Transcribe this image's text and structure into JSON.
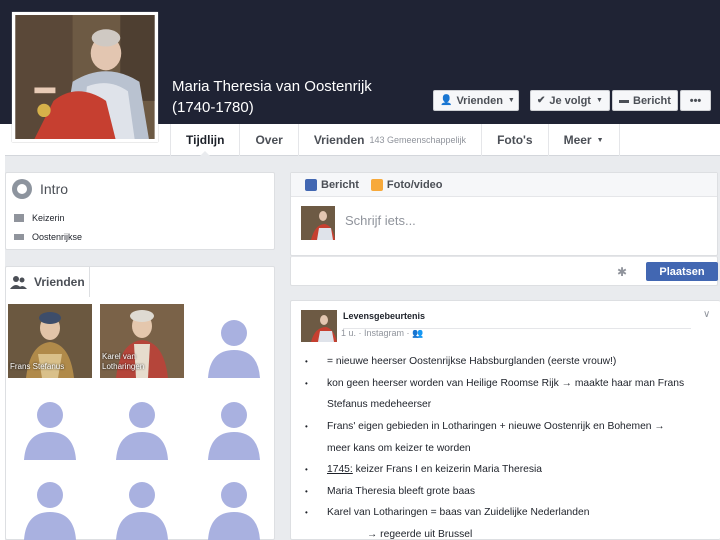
{
  "profile": {
    "name_line1": "Maria Theresia van Oostenrijk",
    "name_line2": "(1740-1780)"
  },
  "header_buttons": {
    "friends": "Vrienden",
    "following": "Je volgt",
    "message": "Bericht",
    "more": "•••"
  },
  "tabs": {
    "timeline": "Tijdlijn",
    "about": "Over",
    "friends": "Vrienden",
    "friends_sub": "143 Gemeenschappelijk",
    "photos": "Foto's",
    "more": "Meer"
  },
  "intro": {
    "title": "Intro",
    "items": [
      "Keizerin",
      "Oostenrijkse"
    ]
  },
  "friends": {
    "title": "Vrienden",
    "people": [
      {
        "name_line1": "Frans Stefanus",
        "name_line2": ""
      },
      {
        "name_line1": "Karel van",
        "name_line2": "Lotharingen"
      }
    ]
  },
  "composer": {
    "tab_post": "Bericht",
    "tab_photo": "Foto/video",
    "placeholder": "Schrijf iets...",
    "submit": "Plaatsen"
  },
  "event": {
    "title": "Levensgebeurtenis",
    "meta": "1 u. · Instagram ·",
    "bullets": [
      "= nieuwe heerser Oostenrijkse Habsburglanden (eerste vrouw!)",
      "kon geen heerser worden van Heilige Roomse Rijk → maakte haar man Frans",
      "Stefanus medeheerser",
      "Frans' eigen gebieden in Lotharingen + nieuwe Oostenrijk en Bohemen →",
      "meer kans om keizer te worden",
      "1745:",
      "keizer Frans I en keizerin Maria Theresia",
      "Maria Theresia bleeft grote baas",
      "Karel van Lotharingen = baas van Zuidelijke Nederlanden",
      "→ regeerde uit Brussel"
    ],
    "bullet_marker": "•"
  },
  "colors": {
    "cover": "#1f2334",
    "brand": "#4267b2",
    "silhouette": "#a9b1e0"
  },
  "icons": {
    "header_friends": "user-check-icon",
    "header_following": "check-icon",
    "header_message": "message-icon",
    "intro": "globe-icon",
    "intro_rows": [
      "briefcase-icon",
      "hat-icon"
    ],
    "composer_post": "pencil-icon",
    "composer_photo": "photo-icon",
    "settings": "gear-icon"
  }
}
